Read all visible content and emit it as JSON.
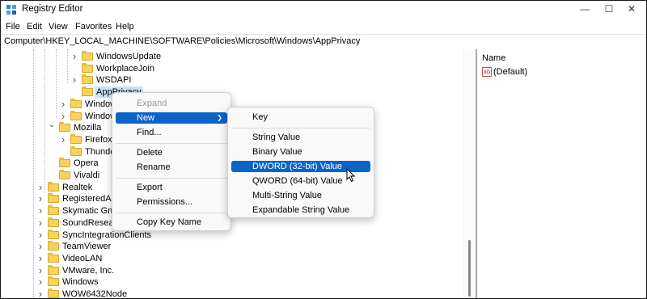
{
  "window": {
    "title": "Registry Editor"
  },
  "menu": [
    "File",
    "Edit",
    "View",
    "Favorites",
    "Help"
  ],
  "address": "Computer\\HKEY_LOCAL_MACHINE\\SOFTWARE\\Policies\\Microsoft\\Windows\\AppPrivacy",
  "tree": [
    {
      "label": "WindowsUpdate",
      "level": 4,
      "expander": "collapsed"
    },
    {
      "label": "WorkplaceJoin",
      "level": 4,
      "expander": "none"
    },
    {
      "label": "WSDAPI",
      "level": 4,
      "expander": "collapsed"
    },
    {
      "label": "AppPrivacy",
      "level": 4,
      "expander": "none",
      "selected": true
    },
    {
      "label": "Window",
      "level": 3,
      "expander": "collapsed"
    },
    {
      "label": "Window",
      "level": 3,
      "expander": "collapsed"
    },
    {
      "label": "Mozilla",
      "level": 2,
      "expander": "expanded"
    },
    {
      "label": "Firefox",
      "level": 3,
      "expander": "collapsed"
    },
    {
      "label": "Thunder",
      "level": 3,
      "expander": "none"
    },
    {
      "label": "Opera",
      "level": 2,
      "expander": "none"
    },
    {
      "label": "Vivaldi",
      "level": 2,
      "expander": "none"
    },
    {
      "label": "Realtek",
      "level": 1,
      "expander": "collapsed"
    },
    {
      "label": "RegisteredApp",
      "level": 1,
      "expander": "collapsed"
    },
    {
      "label": "Skymatic Gmb",
      "level": 1,
      "expander": "collapsed"
    },
    {
      "label": "SoundResearch",
      "level": 1,
      "expander": "collapsed"
    },
    {
      "label": "SyncIntegrationClients",
      "level": 1,
      "expander": "collapsed"
    },
    {
      "label": "TeamViewer",
      "level": 1,
      "expander": "collapsed"
    },
    {
      "label": "VideoLAN",
      "level": 1,
      "expander": "collapsed"
    },
    {
      "label": "VMware, Inc.",
      "level": 1,
      "expander": "collapsed"
    },
    {
      "label": "Windows",
      "level": 1,
      "expander": "collapsed"
    },
    {
      "label": "WOW6432Node",
      "level": 1,
      "expander": "collapsed"
    }
  ],
  "values_pane": {
    "header": "Name",
    "rows": [
      {
        "name": "(Default)",
        "icon": "string-value-icon"
      }
    ]
  },
  "context_menu": {
    "items": [
      {
        "label": "Expand",
        "disabled": true
      },
      {
        "label": "New",
        "highlighted": true,
        "submenu": true
      },
      {
        "label": "Find..."
      },
      {
        "separator": true
      },
      {
        "label": "Delete"
      },
      {
        "label": "Rename"
      },
      {
        "separator": true
      },
      {
        "label": "Export"
      },
      {
        "label": "Permissions..."
      },
      {
        "separator": true
      },
      {
        "label": "Copy Key Name"
      }
    ]
  },
  "submenu": {
    "items": [
      {
        "label": "Key"
      },
      {
        "separator": true
      },
      {
        "label": "String Value"
      },
      {
        "label": "Binary Value"
      },
      {
        "label": "DWORD (32-bit) Value",
        "highlighted": true
      },
      {
        "label": "QWORD (64-bit) Value"
      },
      {
        "label": "Multi-String Value"
      },
      {
        "label": "Expandable String Value"
      }
    ]
  },
  "colors": {
    "highlight": "#0a64c8",
    "selection": "#cce4f7",
    "folder": "#f7d25e"
  }
}
